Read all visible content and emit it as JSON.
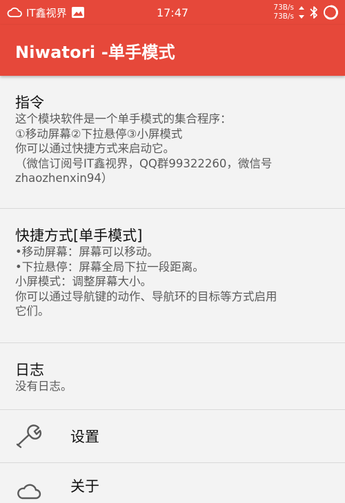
{
  "status_bar": {
    "carrier": "IT鑫视界",
    "time": "17:47",
    "speed_up": "73B/s",
    "speed_down": "73B/s",
    "icons": [
      "notification-cloud-icon",
      "image-icon",
      "bluetooth-icon",
      "battery-icon"
    ]
  },
  "app_bar": {
    "title": "Niwatori -单手模式"
  },
  "preferences": [
    {
      "title": "指令",
      "summary": "这个模块软件是一个单手模式的集合程序：\n①移动屏幕②下拉悬停③小屏模式\n你可以通过快捷方式来启动它。\n（微信订阅号IT鑫视界，QQ群99322260，微信号\nzhaozhenxin94）"
    },
    {
      "title": "快捷方式[单手模式]",
      "summary": "•移动屏幕：屏幕可以移动。\n•下拉悬停：屏幕全局下拉一段距离。\n小屏模式：调整屏幕大小。\n你可以通过导航键的动作、导航环的目标等方式启用\n它们。"
    },
    {
      "title": "日志",
      "summary": "没有日志。"
    }
  ],
  "settings_row": {
    "label": "设置",
    "icon": "wrench-icon"
  },
  "about_row": {
    "label": "关于",
    "icon": "cloud-icon"
  },
  "colors": {
    "accent": "#e6483a",
    "background": "#f3f3f3"
  }
}
